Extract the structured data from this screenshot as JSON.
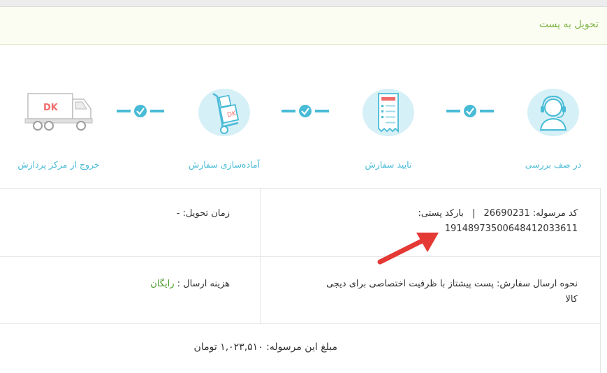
{
  "status": {
    "title": "تحویل به پست"
  },
  "steps": [
    {
      "label": "در صف بررسی",
      "icon": "support-agent-icon"
    },
    {
      "label": "تایید سفارش",
      "icon": "invoice-icon"
    },
    {
      "label": "آماده‌سازی سفارش",
      "icon": "hand-truck-icon"
    },
    {
      "label": "خروج از مرکز پردازش",
      "icon": "delivery-truck-icon"
    }
  ],
  "shipment": {
    "consignment_code_label": "کد مرسوله:",
    "consignment_code": "26690231",
    "separator": "|",
    "barcode_label": "بارکد پستی:",
    "barcode": "19148973500648412033611",
    "delivery_time_label": "زمان تحویل:",
    "delivery_time": "-",
    "shipping_method_label": "نحوه ارسال سفارش:",
    "shipping_method_line1": "پست پیشتاز با ظرفیت اختصاصی برای دیجی",
    "shipping_method_line2": "کالا",
    "shipping_cost_label": "هزینه ارسال :",
    "shipping_cost": "رایگان",
    "amount_label": "مبلغ این مرسوله:",
    "amount": "۱,۰۲۳,۵۱۰ تومان"
  },
  "colors": {
    "step_accent": "#48bbd6",
    "step_bg": "#d6f0f7",
    "status_green": "#7cb342",
    "arrow_red": "#e53935"
  }
}
